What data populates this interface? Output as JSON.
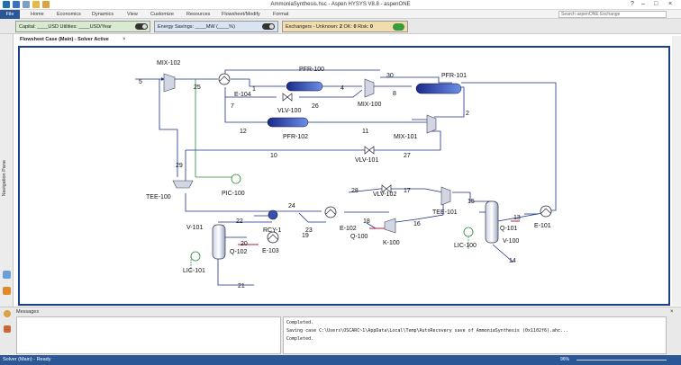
{
  "window": {
    "title": "AmmoniaSynthesis.hsc - Aspen HYSYS V8.8 - aspenONE"
  },
  "ribbon": {
    "file_tab": "File",
    "tabs": [
      "Home",
      "Economics",
      "Dynamics",
      "View",
      "Customize",
      "Resources",
      "Flowsheet/Modify",
      "Format"
    ],
    "search_placeholder": "Search aspenONE Exchange"
  },
  "infobar": {
    "capital": "Capital: ____USD  Utilities: ____USD/Year",
    "energy": "Energy Savings: ____MW  (____%)",
    "exchangers_prefix": "Exchangers - Unknown:",
    "exchangers_unknown": "2",
    "ok_label": "OK:",
    "ok_value": "0",
    "risk_label": "Risk:",
    "risk_value": "0"
  },
  "nav": {
    "navigation_pane": "Navigation Pane"
  },
  "document": {
    "tab_label": "Flowsheet Case (Main) - Solver Active"
  },
  "flowsheet": {
    "blocks": {
      "mix102": "MIX-102",
      "mix100": "MIX-100",
      "mix101": "MIX-101",
      "pfr100": "PFR-100",
      "pfr101": "PFR-101",
      "pfr102": "PFR-102",
      "e104": "E-104",
      "vlv100": "VLV-100",
      "vlv101": "VLV-101",
      "vlv102": "VLV-102",
      "tee100": "TEE-100",
      "tee101": "TEE-101",
      "pic100": "PIC-100",
      "rcy1": "RCY-1",
      "e102": "E-102",
      "q100": "Q-100",
      "k100": "K-100",
      "v101": "V-101",
      "q102": "Q-102",
      "e103": "E-103",
      "lic101": "LIC-101",
      "q101": "Q-101",
      "lic100": "LIC-100",
      "v100": "V-100",
      "e101": "E-101"
    },
    "streams": [
      "5",
      "25",
      "1",
      "4",
      "30",
      "8",
      "2",
      "7",
      "26",
      "12",
      "11",
      "10",
      "27",
      "29",
      "28",
      "17",
      "24",
      "22",
      "18",
      "16",
      "15",
      "13",
      "19",
      "20",
      "23",
      "21",
      "14"
    ]
  },
  "messages": {
    "title": "Messages",
    "lines": [
      "Completed.",
      "Saving case C:\\Users\\OSCARC~1\\AppData\\Local\\Temp\\AutoRecovery save of AmmoniaSynthesis (0x1102f6).ahc...",
      "Completed."
    ]
  },
  "status": {
    "text": "Solver (Main) - Ready",
    "zoom": "96%"
  },
  "colors": {
    "accent": "#2b5797",
    "canvas_border": "#1c3f8c",
    "stream_blue": "#1a2f8a",
    "energy_red": "#c0143c"
  }
}
